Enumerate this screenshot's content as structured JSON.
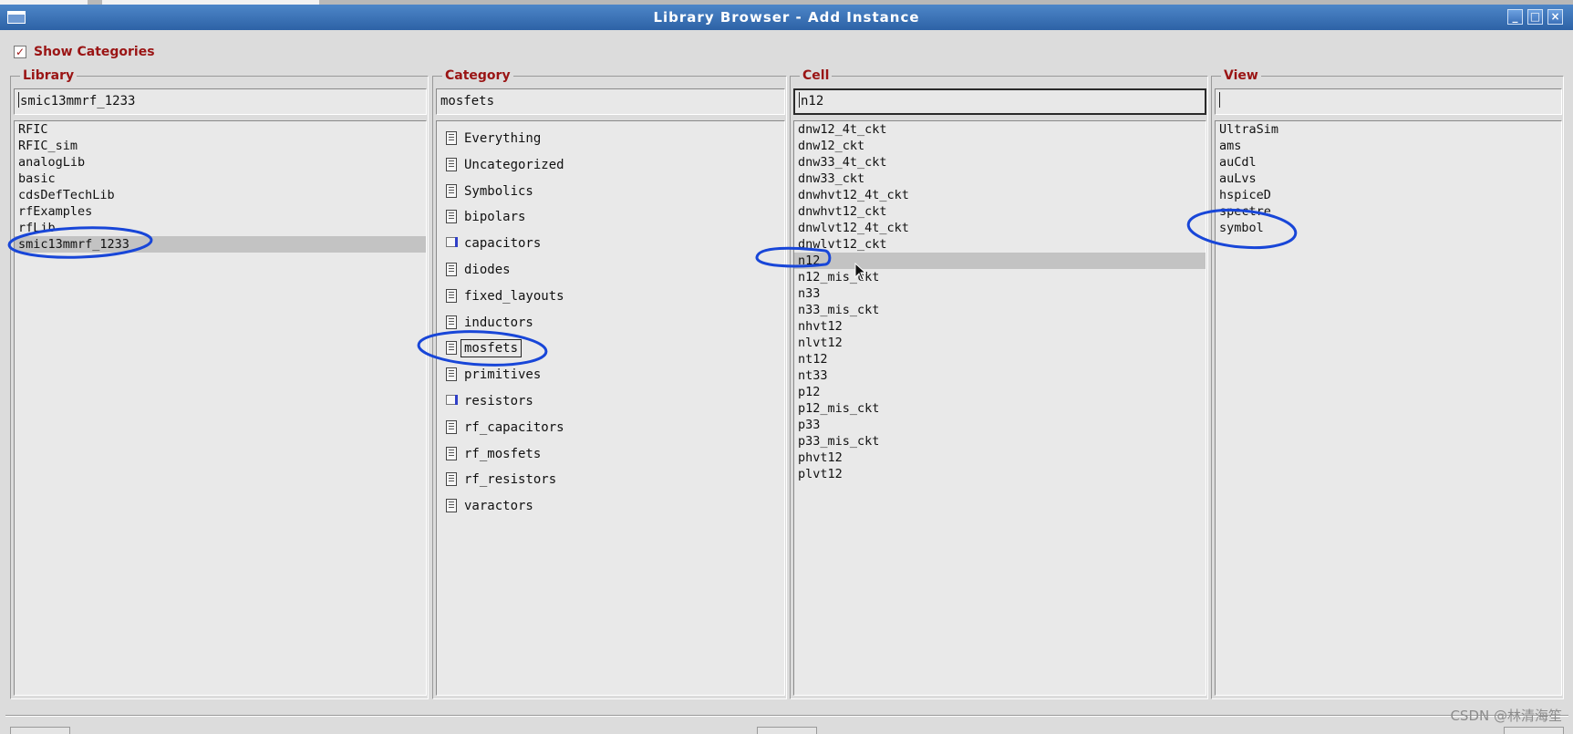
{
  "window": {
    "title": "Library Browser - Add Instance",
    "buttons": [
      "minimize",
      "maximize",
      "close"
    ]
  },
  "show_categories": {
    "label": "Show Categories",
    "checked": true
  },
  "library": {
    "title": "Library",
    "filter_value": "smic13mmrf_1233",
    "items": [
      "RFIC",
      "RFIC_sim",
      "analogLib",
      "basic",
      "cdsDefTechLib",
      "rfExamples",
      "rfLib",
      "smic13mmrf_1233"
    ],
    "selected": "smic13mmrf_1233"
  },
  "category": {
    "title": "Category",
    "filter_value": "mosfets",
    "items": [
      {
        "label": "Everything",
        "icon": "category-icon"
      },
      {
        "label": "Uncategorized",
        "icon": "category-icon"
      },
      {
        "label": "Symbolics",
        "icon": "category-icon"
      },
      {
        "label": "bipolars",
        "icon": "category-icon"
      },
      {
        "label": "capacitors",
        "icon": "empty-category-icon"
      },
      {
        "label": "diodes",
        "icon": "category-icon"
      },
      {
        "label": "fixed_layouts",
        "icon": "category-icon"
      },
      {
        "label": "inductors",
        "icon": "category-icon"
      },
      {
        "label": "mosfets",
        "icon": "category-icon"
      },
      {
        "label": "primitives",
        "icon": "category-icon"
      },
      {
        "label": "resistors",
        "icon": "empty-category-icon"
      },
      {
        "label": "rf_capacitors",
        "icon": "category-icon"
      },
      {
        "label": "rf_mosfets",
        "icon": "category-icon"
      },
      {
        "label": "rf_resistors",
        "icon": "category-icon"
      },
      {
        "label": "varactors",
        "icon": "category-icon"
      }
    ],
    "selected": "mosfets"
  },
  "cell": {
    "title": "Cell",
    "filter_value": "n12",
    "items": [
      "dnw12_4t_ckt",
      "dnw12_ckt",
      "dnw33_4t_ckt",
      "dnw33_ckt",
      "dnwhvt12_4t_ckt",
      "dnwhvt12_ckt",
      "dnwlvt12_4t_ckt",
      "dnwlvt12_ckt",
      "n12",
      "n12_mis_ckt",
      "n33",
      "n33_mis_ckt",
      "nhvt12",
      "nlvt12",
      "nt12",
      "nt33",
      "p12",
      "p12_mis_ckt",
      "p33",
      "p33_mis_ckt",
      "phvt12",
      "plvt12"
    ],
    "selected": "n12"
  },
  "view": {
    "title": "View",
    "filter_value": "",
    "items": [
      "UltraSim",
      "ams",
      "auCdl",
      "auLvs",
      "hspiceD",
      "spectre",
      "symbol"
    ]
  },
  "watermark": "CSDN @林清海笙",
  "colors": {
    "title_bar": "#3a6fb5",
    "label_red": "#9a1414",
    "annotation_blue": "#1846d8",
    "selection": "#c3c3c3"
  }
}
